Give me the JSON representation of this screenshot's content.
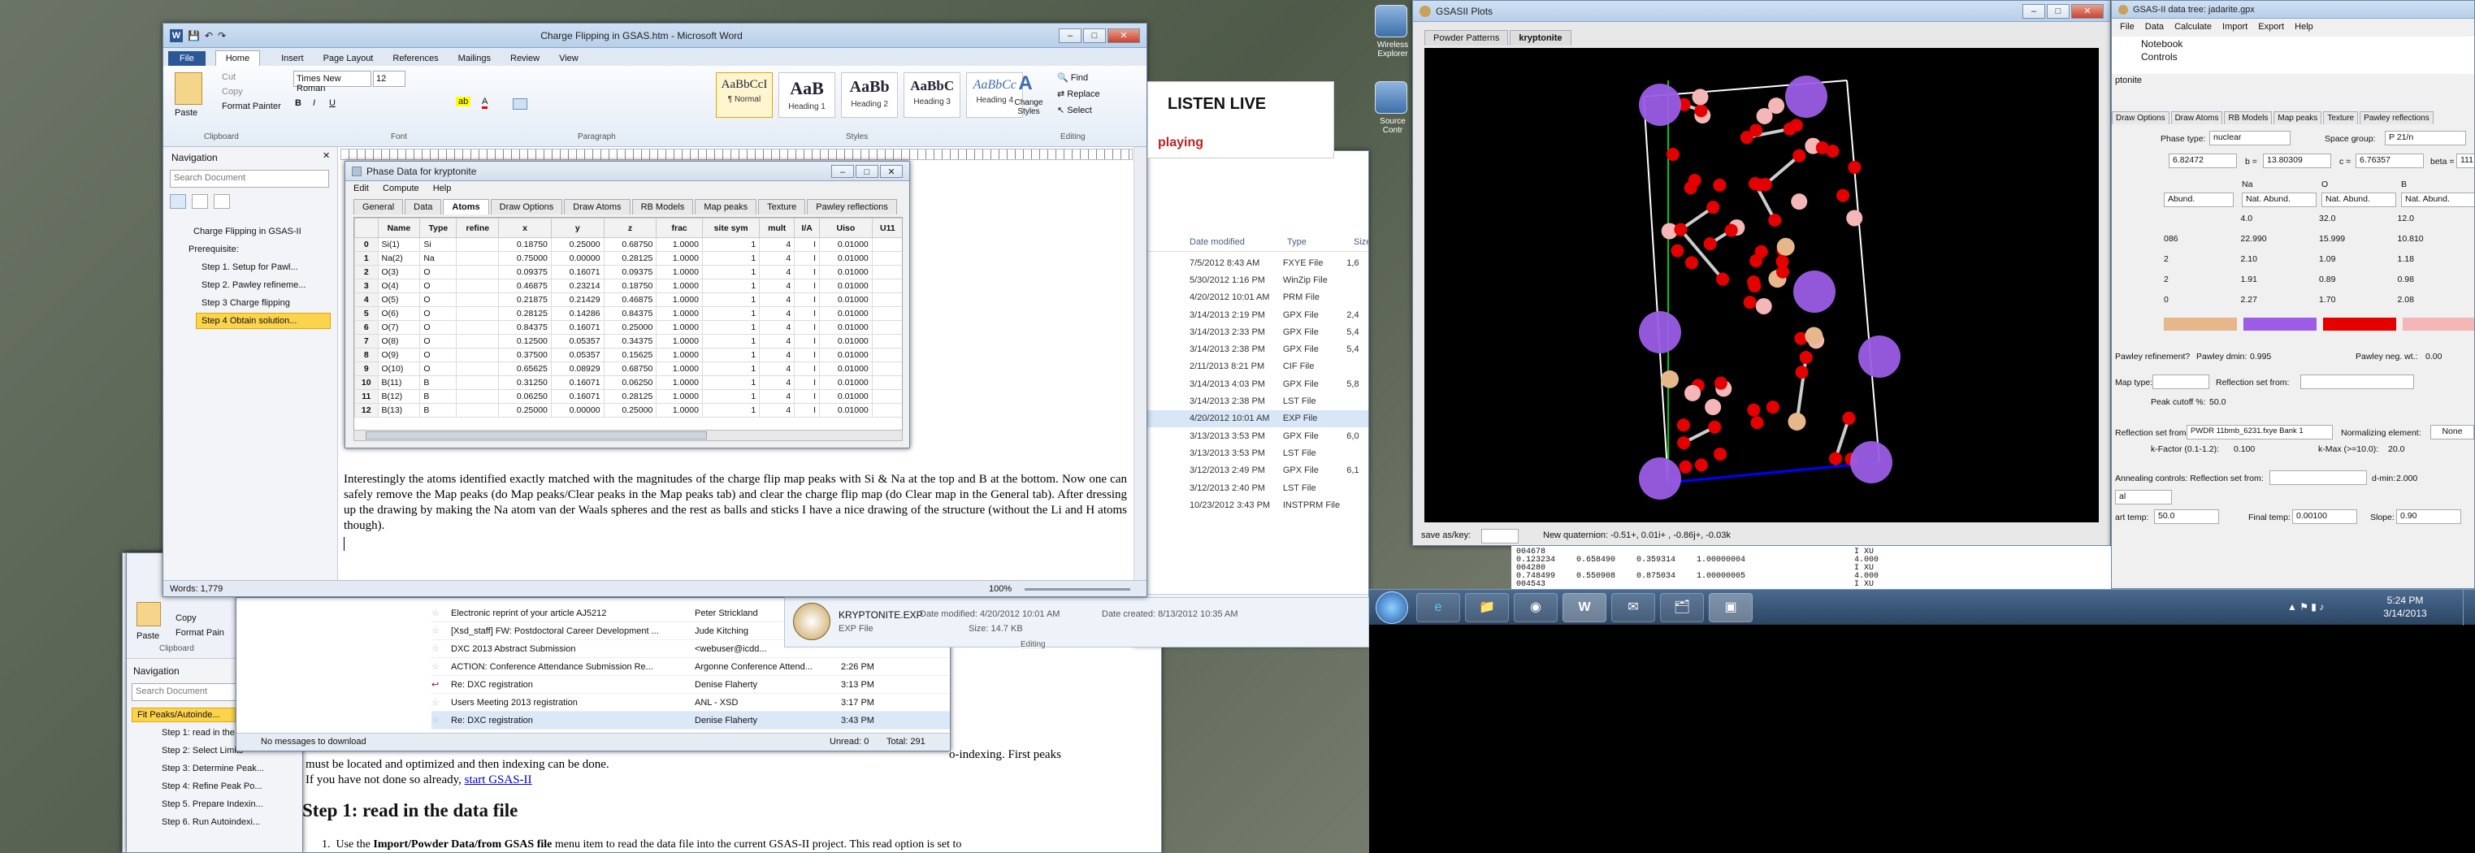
{
  "word": {
    "title": "Charge Flipping in GSAS.htm - Microsoft Word",
    "tabs": [
      "File",
      "Home",
      "Insert",
      "Page Layout",
      "References",
      "Mailings",
      "Review",
      "View"
    ],
    "clipboard": {
      "paste": "Paste",
      "cut": "Cut",
      "copy": "Copy",
      "format_painter": "Format Painter",
      "group": "Clipboard"
    },
    "font": {
      "name": "Times New Roman",
      "size": "12",
      "group": "Font"
    },
    "paragraph_group": "Paragraph",
    "styles": [
      {
        "preview": "AaBbCcI",
        "name": "¶ Normal"
      },
      {
        "preview": "AaB",
        "name": "Heading 1"
      },
      {
        "preview": "AaBb",
        "name": "Heading 2"
      },
      {
        "preview": "AaBbC",
        "name": "Heading 3"
      },
      {
        "preview": "AaBbCc",
        "name": "Heading 4"
      }
    ],
    "styles_group": "Styles",
    "change_styles": "Change Styles",
    "editing": {
      "find": "Find",
      "replace": "Replace",
      "select": "Select",
      "group": "Editing"
    },
    "nav": {
      "title": "Navigation",
      "search": "Search Document",
      "items": [
        "Charge Flipping in GSAS-II",
        "Prerequisite:",
        "Step 1. Setup for Pawl...",
        "Step 2. Pawley refineme...",
        "Step 3 Charge flipping",
        "Step 4 Obtain solution..."
      ]
    },
    "body_text": "Interestingly the atoms identified exactly matched with the magnitudes of the charge flip map peaks with Si & Na at the top and B at the bottom. Now one can safely remove the Map peaks (do Map peaks/Clear peaks in the Map peaks tab) and clear the charge flip map (do Clear map in the General tab). After dressing up the drawing by making the Na atom van der Waals spheres and the rest as balls and sticks I have a nice drawing of the structure (without the Li and H atoms though).",
    "status_words": "Words: 1,779",
    "zoom": "100%",
    "listen_live": "LISTEN LIVE",
    "playing": "playing"
  },
  "phase": {
    "title": "Phase Data for kryptonite",
    "menu": [
      "Edit",
      "Compute",
      "Help"
    ],
    "tabs": [
      "General",
      "Data",
      "Atoms",
      "Draw Options",
      "Draw Atoms",
      "RB Models",
      "Map peaks",
      "Texture",
      "Pawley reflections"
    ],
    "columns": [
      "",
      "Name",
      "Type",
      "refine",
      "x",
      "y",
      "z",
      "frac",
      "site sym",
      "mult",
      "I/A",
      "Uiso",
      "U11"
    ],
    "rows": [
      [
        "0",
        "Si(1)",
        "Si",
        "",
        "0.18750",
        "0.25000",
        "0.68750",
        "1.0000",
        "1",
        "4",
        "I",
        "0.01000",
        ""
      ],
      [
        "1",
        "Na(2)",
        "Na",
        "",
        "0.75000",
        "0.00000",
        "0.28125",
        "1.0000",
        "1",
        "4",
        "I",
        "0.01000",
        ""
      ],
      [
        "2",
        "O(3)",
        "O",
        "",
        "0.09375",
        "0.16071",
        "0.09375",
        "1.0000",
        "1",
        "4",
        "I",
        "0.01000",
        ""
      ],
      [
        "3",
        "O(4)",
        "O",
        "",
        "0.46875",
        "0.23214",
        "0.18750",
        "1.0000",
        "1",
        "4",
        "I",
        "0.01000",
        ""
      ],
      [
        "4",
        "O(5)",
        "O",
        "",
        "0.21875",
        "0.21429",
        "0.46875",
        "1.0000",
        "1",
        "4",
        "I",
        "0.01000",
        ""
      ],
      [
        "5",
        "O(6)",
        "O",
        "",
        "0.28125",
        "0.14286",
        "0.84375",
        "1.0000",
        "1",
        "4",
        "I",
        "0.01000",
        ""
      ],
      [
        "6",
        "O(7)",
        "O",
        "",
        "0.84375",
        "0.16071",
        "0.25000",
        "1.0000",
        "1",
        "4",
        "I",
        "0.01000",
        ""
      ],
      [
        "7",
        "O(8)",
        "O",
        "",
        "0.12500",
        "0.05357",
        "0.34375",
        "1.0000",
        "1",
        "4",
        "I",
        "0.01000",
        ""
      ],
      [
        "8",
        "O(9)",
        "O",
        "",
        "0.37500",
        "0.05357",
        "0.15625",
        "1.0000",
        "1",
        "4",
        "I",
        "0.01000",
        ""
      ],
      [
        "9",
        "O(10)",
        "O",
        "",
        "0.65625",
        "0.08929",
        "0.68750",
        "1.0000",
        "1",
        "4",
        "I",
        "0.01000",
        ""
      ],
      [
        "10",
        "B(11)",
        "B",
        "",
        "0.31250",
        "0.16071",
        "0.06250",
        "1.0000",
        "1",
        "4",
        "I",
        "0.01000",
        ""
      ],
      [
        "11",
        "B(12)",
        "B",
        "",
        "0.06250",
        "0.16071",
        "0.28125",
        "1.0000",
        "1",
        "4",
        "I",
        "0.01000",
        ""
      ],
      [
        "12",
        "B(13)",
        "B",
        "",
        "0.25000",
        "0.00000",
        "0.25000",
        "1.0000",
        "1",
        "4",
        "I",
        "0.01000",
        ""
      ]
    ]
  },
  "explorer": {
    "columns": [
      "Date modified",
      "Type",
      "Size"
    ],
    "rows": [
      [
        "7/5/2012 8:43 AM",
        "FXYE File",
        "1,6"
      ],
      [
        "5/30/2012 1:16 PM",
        "WinZip File",
        ""
      ],
      [
        "4/20/2012 10:01 AM",
        "PRM File",
        ""
      ],
      [
        "3/14/2013 2:19 PM",
        "GPX File",
        "2,4"
      ],
      [
        "3/14/2013 2:33 PM",
        "GPX File",
        "5,4"
      ],
      [
        "3/14/2013 2:38 PM",
        "GPX File",
        "5,4"
      ],
      [
        "2/11/2013 8:21 PM",
        "CIF File",
        ""
      ],
      [
        "3/14/2013 4:03 PM",
        "GPX File",
        "5,8"
      ],
      [
        "3/14/2013 2:38 PM",
        "LST File",
        ""
      ],
      [
        "4/20/2012 10:01 AM",
        "EXP File",
        ""
      ],
      [
        "3/13/2013 3:53 PM",
        "GPX File",
        "6,0"
      ],
      [
        "3/13/2013 3:53 PM",
        "LST File",
        ""
      ],
      [
        "3/12/2013 2:49 PM",
        "GPX File",
        "6,1"
      ],
      [
        "3/12/2013 2:40 PM",
        "LST File",
        ""
      ],
      [
        "10/23/2012 3:43 PM",
        "INSTPRM File",
        ""
      ]
    ],
    "detail_name": "KRYPTONITE.EXP",
    "detail_type": "EXP File",
    "detail_modified": "Date modified: 4/20/2012 10:01 AM",
    "detail_created": "Date created: 8/13/2012 10:35 AM",
    "detail_size": "Size: 14.7 KB"
  },
  "mail": {
    "rows": [
      [
        "Electronic reprint of your article AJ5212",
        "Peter Strickland",
        ""
      ],
      [
        "[Xsd_staff] FW: Postdoctoral Career Development ...",
        "Jude Kitching",
        ""
      ],
      [
        "DXC 2013 Abstract Submission",
        "<webuser@icdd...",
        ""
      ],
      [
        "ACTION: Conference Attendance Submission Re...",
        "Argonne Conference Attend...",
        "2:26 PM"
      ],
      [
        "Re: DXC registration",
        "Denise Flaherty",
        "3:13 PM"
      ],
      [
        "Users Meeting 2013 registration",
        "ANL - XSD",
        "3:17 PM"
      ],
      [
        "Re: DXC registration",
        "Denise Flaherty",
        "3:43 PM"
      ]
    ],
    "status": "No messages to download",
    "unread": "Unread: 0",
    "total": "Total: 291",
    "editing": "Editing"
  },
  "word2": {
    "nav_title": "Navigation",
    "search": "Search Document",
    "items": [
      "Fit Peaks/Autoinde...",
      "Step 1: read in the dat...",
      "Step 2: Select Limits",
      "Step 3: Determine Peak...",
      "Step 4: Refine Peak Po...",
      "Step 5. Prepare Indexin...",
      "Step 6. Run Autoindexi..."
    ],
    "text1": "o-indexing. First peaks",
    "text2": "must be located and optimized and then indexing can be done.",
    "text3": "If you have not done so already,",
    "link": "start GSAS-II",
    "heading": "Step 1: read in the data file",
    "list1": "Use the",
    "list1b": "Import/Powder Data/from GSAS file",
    "list1c": "menu item to read the data file into the current GSAS-II project. This read option is set to",
    "clipboard": "Clipboard",
    "copy": "Copy",
    "paste": "Paste",
    "format_paint": "Format Pain"
  },
  "plots": {
    "title": "GSASII Plots",
    "tabs": [
      "Powder Patterns",
      "kryptonite"
    ],
    "save_as": "save as/key:",
    "quaternion": "New quaternion: -0.51+, 0.01i+ , -0.86j+, -0.03k"
  },
  "datatree": {
    "title": "GSAS-II data tree: jadarite.gpx",
    "menu": [
      "File",
      "Data",
      "Calculate",
      "Import",
      "Export",
      "Help"
    ],
    "tree": [
      "Notebook",
      "Controls"
    ],
    "tree_tail": "ptonite",
    "tabs": [
      "Draw Options",
      "Draw Atoms",
      "RB Models",
      "Map peaks",
      "Texture",
      "Pawley reflections"
    ],
    "phase_type_label": "Phase type:",
    "phase_type": "nuclear",
    "space_group_label": "Space group:",
    "space_group": "P 21/n",
    "a_val": "6.82472",
    "b_label": "b =",
    "b_val": "13.80309",
    "c_label": "c =",
    "c_val": "6.76357",
    "beta_label": "beta =",
    "beta_val": "111",
    "elem_headers": [
      "Na",
      "O",
      "B"
    ],
    "abund_label": "Abund.",
    "nat_abund_label": "Nat. Abund.",
    "elem_rows": [
      [
        "",
        "4.0",
        "32.0",
        "12.0"
      ],
      [
        "086",
        "22.990",
        "15.999",
        "10.810"
      ],
      [
        "2",
        "2.10",
        "1.09",
        "1.18"
      ],
      [
        "2",
        "1.91",
        "0.89",
        "0.98"
      ],
      [
        "0",
        "2.27",
        "1.70",
        "2.08"
      ]
    ],
    "elem_colors": [
      "#e5b78a",
      "#9b5de5",
      "#e50000",
      "#f4b6b6"
    ],
    "pawley_refine": "Pawley refinement?",
    "pawley_dmin_label": "Pawley dmin:",
    "pawley_dmin": "0.995",
    "pawley_neg_label": "Pawley neg. wt.:",
    "pawley_neg": "0.00",
    "map_type_label": "Map type:",
    "refl_set_label": "Reflection set from:",
    "peak_cutoff_label": "Peak cutoff %:",
    "peak_cutoff": "50.0",
    "refl_set2_label": "Reflection set from:",
    "refl_set2": "PWDR 11bmb_6231.fxye Bank 1",
    "normalizing_label": "Normalizing element:",
    "normalizing": "None",
    "kfactor_label": "k-Factor (0.1-1.2):",
    "kfactor": "0.100",
    "kmax_label": "k-Max (>=10.0):",
    "kmax": "20.0",
    "annealing_label": "Annealing controls: Reflection set from:",
    "dmin_label": "d-min:",
    "dmin": "2.000",
    "al_val": "al",
    "start_temp_label": "art temp:",
    "start_temp": "50.0",
    "final_temp_label": "Final temp:",
    "final_temp": "0.00100",
    "slope_label": "Slope:",
    "slope": "0.90",
    "log_lines": [
      [
        "004678",
        "",
        "",
        "",
        "I XU"
      ],
      [
        "0.123234",
        "0.658490",
        "0.359314",
        "1.00000004",
        "4.000"
      ],
      [
        "004280",
        "",
        "",
        "",
        "I XU"
      ],
      [
        "0.748499",
        "0.550908",
        "0.875034",
        "1.00000005",
        "4.000"
      ],
      [
        "004543",
        "",
        "",
        "",
        "I XU"
      ]
    ]
  },
  "taskbar": {
    "time": "5:24 PM",
    "date": "3/14/2013"
  },
  "desktop_icons": [
    "Wireless Explorer",
    "Source Contr"
  ]
}
